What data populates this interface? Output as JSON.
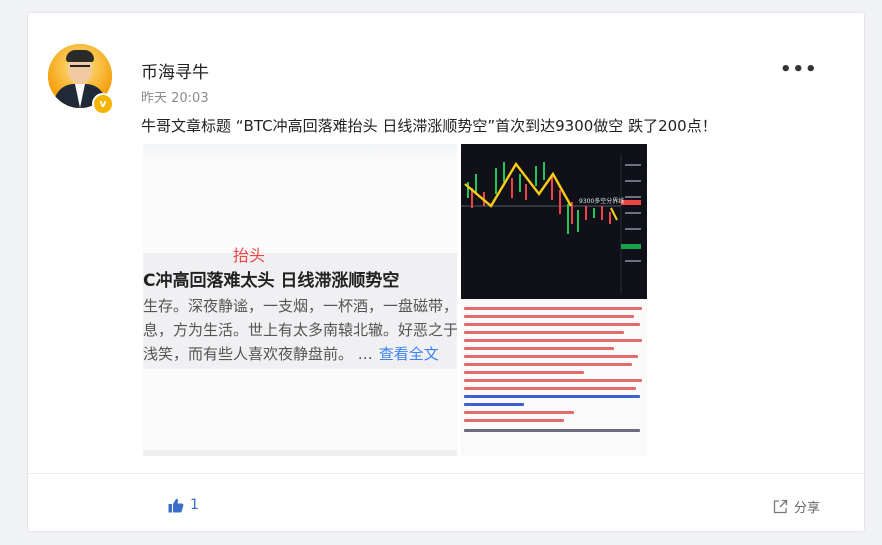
{
  "post": {
    "username": "币海寻牛",
    "time": "昨天 20:03",
    "verified_mark": "v",
    "more_label": "•••",
    "text": "牛哥文章标题 “BTC冲高回落难抬头 日线滞涨顺势空”首次到达9300做空 跌了200点！"
  },
  "image1": {
    "red_label": "抬头",
    "headline": "C冲高回落难太头 日线滞涨顺势空",
    "line1": "生存。深夜静谧，一支烟，一杯酒，一盘磁带，",
    "line2": "息，方为生活。世上有太多南辕北辙。好恶之于",
    "line3": "浅笑，而有些人喜欢夜静盘前。 …",
    "read_more": "查看全文"
  },
  "image2": {
    "chart_label": "9300多空分界线"
  },
  "footer": {
    "like_count": "1",
    "share_label": "分享"
  },
  "icons": {
    "like": "thumbs-up-icon",
    "share": "share-icon",
    "more": "more-icon"
  },
  "colors": {
    "link": "#3b82f6",
    "highlight": "#ef4444",
    "badge": "#f5b400",
    "like": "#3b6ec6"
  }
}
